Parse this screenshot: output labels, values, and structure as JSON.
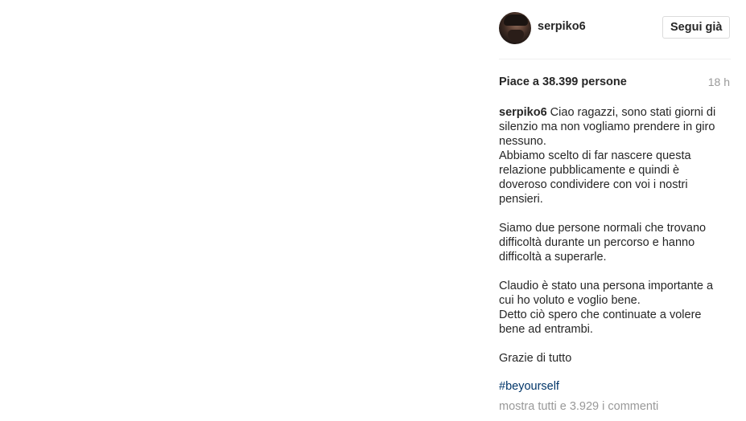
{
  "header": {
    "username": "serpiko6",
    "follow_label": "Segui già"
  },
  "stats": {
    "likes": "Piace a 38.399 persone",
    "time": "18 h"
  },
  "caption": {
    "author": "serpiko6",
    "line1": " Ciao ragazzi, sono stati giorni di silenzio ma non vogliamo prendere in giro nessuno.",
    "line2": "Abbiamo scelto di far nascere questa relazione pubblicamente e quindi è doveroso condividere con voi i nostri pensieri.",
    "line3": "Siamo due persone normali che trovano difficoltà durante un percorso e hanno difficoltà a superarle.",
    "line4": "Claudio è stato una persona importante a cui ho voluto e voglio bene.",
    "line5": "Detto ciò spero che continuate a volere bene ad entrambi.",
    "line6": "Grazie di tutto"
  },
  "hashtag": "#beyourself",
  "comments": {
    "show_all": "mostra tutti e 3.929 i commenti"
  }
}
